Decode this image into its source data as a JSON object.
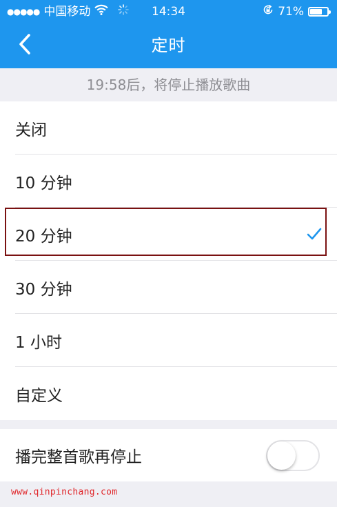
{
  "status_bar": {
    "signal_dots": "●●●●●",
    "carrier": "中国移动",
    "wifi_icon": "wifi-icon",
    "loading_icon": "activity-spinner-icon",
    "time": "14:34",
    "rotation_lock_icon": "rotation-lock-icon",
    "battery_percent": "71%",
    "battery_level": 0.71
  },
  "navbar": {
    "back_icon": "chevron-left-icon",
    "title": "定时"
  },
  "info": {
    "text": "19:58后，将停止播放歌曲"
  },
  "options": [
    {
      "label": "关闭",
      "selected": false
    },
    {
      "label": "10 分钟",
      "selected": false
    },
    {
      "label": "20 分钟",
      "selected": true
    },
    {
      "label": "30 分钟",
      "selected": false
    },
    {
      "label": "1 小时",
      "selected": false
    },
    {
      "label": "自定义",
      "selected": false
    }
  ],
  "stop_after_song": {
    "label": "播完整首歌再停止",
    "enabled": false
  },
  "watermark": "www.qinpinchang.com",
  "colors": {
    "accent": "#1e96ee",
    "check": "#1e96ee",
    "highlight_border": "#7a1111",
    "background": "#efeff4",
    "watermark": "#e0262a"
  }
}
